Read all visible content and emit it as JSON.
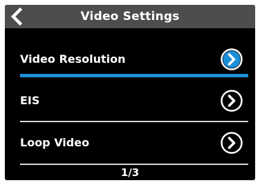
{
  "header": {
    "title": "Video Settings",
    "back_icon": "chevron-left-icon"
  },
  "menu": {
    "items": [
      {
        "label": "Video Resolution",
        "selected": true,
        "icon": "chevron-right-circle-icon"
      },
      {
        "label": "EIS",
        "selected": false,
        "icon": "chevron-right-circle-icon"
      },
      {
        "label": "Loop Video",
        "selected": false,
        "icon": "chevron-right-circle-icon"
      }
    ]
  },
  "footer": {
    "page_indicator": "1/3"
  },
  "colors": {
    "background": "#000000",
    "title_bar": "#4d4d4d",
    "accent": "#1c8fd6",
    "divider": "#d8d8d8",
    "text": "#ffffff"
  }
}
